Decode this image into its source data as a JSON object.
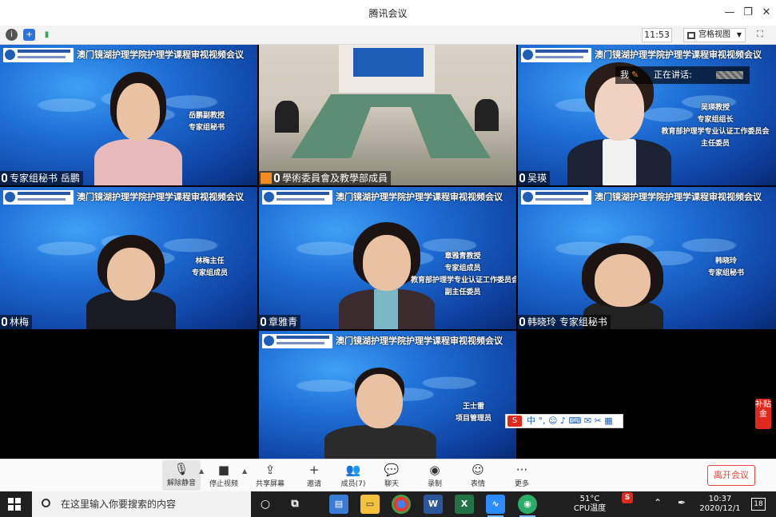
{
  "window": {
    "title": "腾讯会议"
  },
  "infobar": {
    "time": "11:53",
    "view_label": "宫格视图"
  },
  "speaking": {
    "me": "我",
    "label": "正在讲话:"
  },
  "banner": "澳门镜湖护理学院护理学课程审视视频会议",
  "room_screen": "",
  "tiles": [
    {
      "name": "专家组秘书 岳鹏",
      "caption": [
        "岳鹏副教授",
        "专家组秘书"
      ]
    },
    {
      "name": "學術委員會及教學部成員",
      "caption": []
    },
    {
      "name": "吴瑛",
      "caption": [
        "吴瑛教授",
        "专家组组长",
        "教育部护理学专业认证工作委员会",
        "主任委员"
      ]
    },
    {
      "name": "林梅",
      "caption": [
        "林梅主任",
        "专家组成员"
      ]
    },
    {
      "name": "章雅青",
      "caption": [
        "章雅青教授",
        "专家组成员",
        "教育部护理学专业认证工作委员会",
        "副主任委员"
      ]
    },
    {
      "name": "韩晓玲 专家组秘书",
      "caption": [
        "韩晓玲",
        "专家组秘书"
      ]
    },
    {
      "name": "",
      "caption": [
        "王士雷",
        "项目管理员"
      ]
    }
  ],
  "ime": {
    "logo": "S",
    "text": "中 °, ☺ ♪ ⌨ ✉ ✂ ▦"
  },
  "side_button": "补贴金",
  "toolbar": {
    "items": [
      {
        "label": "解除静音",
        "icon": "🎙"
      },
      {
        "label": "停止视频",
        "icon": "■"
      },
      {
        "label": "共享屏幕",
        "icon": "⇪"
      },
      {
        "label": "邀请",
        "icon": "+"
      },
      {
        "label": "成员(7)",
        "icon": "👥"
      },
      {
        "label": "聊天",
        "icon": "💬"
      },
      {
        "label": "录制",
        "icon": "◉"
      },
      {
        "label": "表情",
        "icon": "☺"
      },
      {
        "label": "更多",
        "icon": "···"
      }
    ],
    "leave": "离开会议"
  },
  "taskbar": {
    "search_placeholder": "在这里输入你要搜索的内容",
    "temp": "51°C",
    "temp_label": "CPU温度",
    "time": "10:37",
    "date": "2020/12/1",
    "badge": "18"
  }
}
